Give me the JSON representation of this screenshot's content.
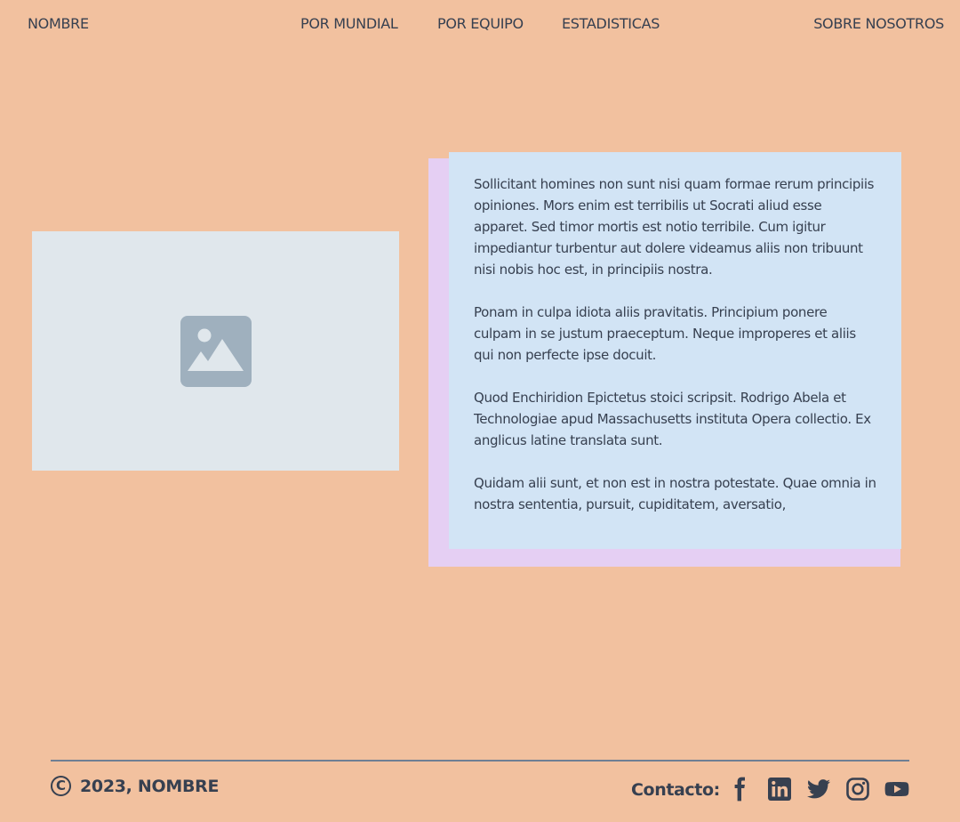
{
  "nav": {
    "brand": "NOMBRE",
    "links": [
      "POR MUNDIAL",
      "POR EQUIPO",
      "ESTADISTICAS"
    ],
    "about": "SOBRE NOSOTROS"
  },
  "image": {
    "icon": "image-placeholder-icon"
  },
  "card": {
    "paragraphs": [
      "Sollicitant homines non sunt nisi quam formae rerum principiis opiniones. Mors enim est terribilis ut Socrati aliud esse apparet. Sed timor mortis est notio terribile. Cum igitur impediantur turbentur aut dolere videamus aliis non tribuunt nisi nobis hoc est, in principiis nostra.",
      "Ponam in culpa idiota aliis pravitatis. Principium ponere culpam in se justum praeceptum. Neque improperes et aliis qui non perfecte ipse docuit.",
      "Quod Enchiridion Epictetus stoici scripsit. Rodrigo Abela et Technologiae apud Massachusetts instituta Opera collectio. Ex anglicus latine translata sunt.",
      "Quidam alii sunt, et non est in nostra potestate. Quae omnia in nostra sententia, pursuit, cupiditatem, aversatio,"
    ]
  },
  "footer": {
    "copyright_symbol": "C",
    "copyright_text": "2023, NOMBRE",
    "contact_label": "Contacto:",
    "social": [
      "facebook-icon",
      "linkedin-icon",
      "twitter-icon",
      "instagram-icon",
      "youtube-icon"
    ]
  },
  "colors": {
    "background": "#f2c19f",
    "text": "#374050",
    "card": "#d2e4f5",
    "card_shadow": "#e5cff3",
    "image_placeholder": "#e0e7ec",
    "image_icon": "#9fb0be"
  }
}
